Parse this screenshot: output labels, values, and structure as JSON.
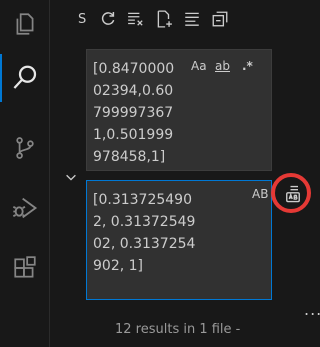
{
  "activity_bar": {
    "items": [
      {
        "icon": "files-icon"
      },
      {
        "icon": "search-icon",
        "active": true
      },
      {
        "icon": "source-control-icon"
      },
      {
        "icon": "run-debug-icon"
      },
      {
        "icon": "extensions-icon"
      }
    ],
    "accent_color": "#0078d4"
  },
  "toolbar": {
    "s_label": "S",
    "buttons": [
      "refresh-icon",
      "clear-results-icon",
      "new-search-editor-icon",
      "view-as-tree-icon",
      "collapse-all-icon"
    ]
  },
  "search": {
    "value": "[0.8470000 02394,0.60 799997367 1,0.501999 978458,1]",
    "options": {
      "match_case": "Aa",
      "match_whole_word": "ab",
      "use_regex": ".*"
    }
  },
  "replace": {
    "value": "[0.313725490 2, 0.3137254902, 0.3137254902, 1]",
    "preserve_case": "AB",
    "replace_all_icon": "replace-all-icon",
    "highlight_color": "#e53935"
  },
  "more_label": "...",
  "results": {
    "summary": "12 results in 1 file -"
  }
}
